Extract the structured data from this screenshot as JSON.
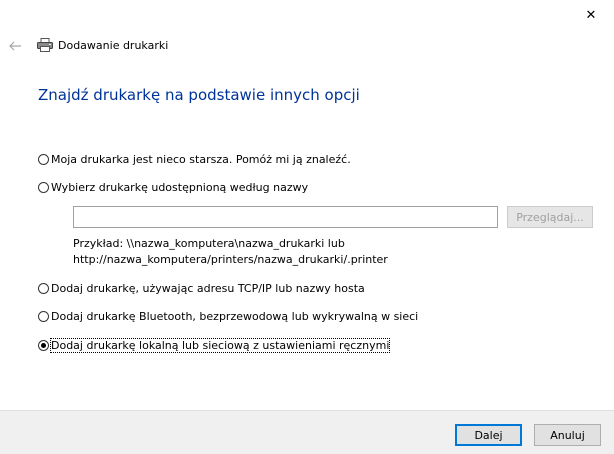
{
  "window": {
    "close_glyph": "✕",
    "back_glyph": "←",
    "title": "Dodawanie drukarki"
  },
  "heading": "Znajdź drukarkę na podstawie innych opcji",
  "options": [
    {
      "label": "Moja drukarka jest nieco starsza. Pomóż mi ją znaleźć.",
      "checked": false
    },
    {
      "label": "Wybierz drukarkę udostępnioną według nazwy",
      "checked": false
    },
    {
      "label": "Dodaj drukarkę, używając adresu TCP/IP lub nazwy hosta",
      "checked": false
    },
    {
      "label": "Dodaj drukarkę Bluetooth, bezprzewodową lub wykrywalną w sieci",
      "checked": false
    },
    {
      "label": "Dodaj drukarkę lokalną lub sieciową z ustawieniami ręcznymi",
      "checked": true
    }
  ],
  "shared_printer": {
    "value": "",
    "browse_label": "Przeglądaj...",
    "example_line1": "Przykład: \\\\nazwa_komputera\\nazwa_drukarki lub",
    "example_line2": "http://nazwa_komputera/printers/nazwa_drukarki/.printer"
  },
  "footer": {
    "next_label": "Dalej",
    "cancel_label": "Anuluj"
  },
  "colors": {
    "heading": "#003399",
    "default_button_border": "#0078d7"
  },
  "icons": {
    "back": "back-arrow-icon",
    "printer": "printer-icon",
    "close": "close-icon"
  }
}
